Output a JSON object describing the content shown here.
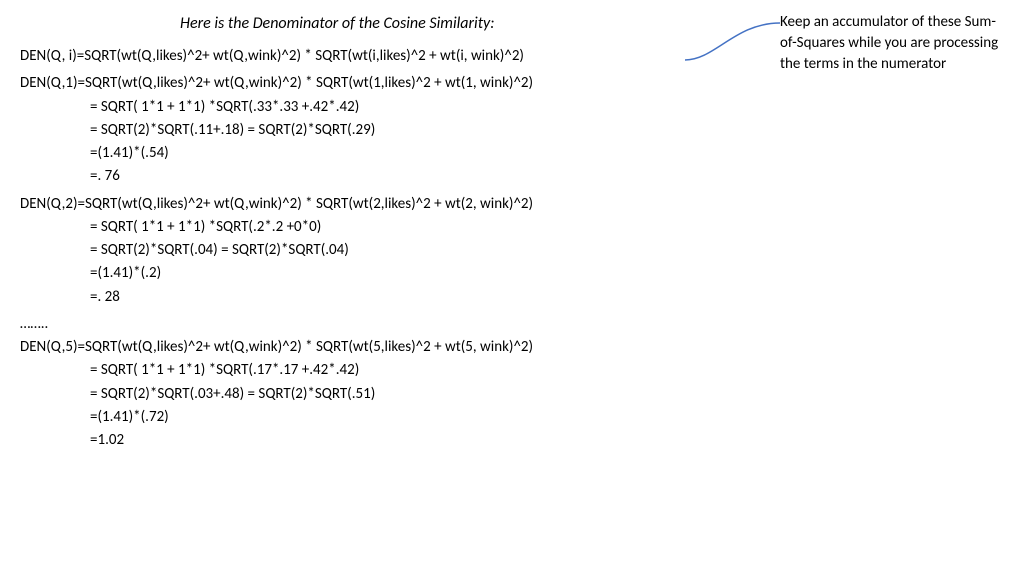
{
  "title": "Here is the Denominator of the Cosine Similarity:",
  "general": "DEN(Q, i)=SQRT(wt(Q,likes)^2+ wt(Q,wink)^2) * SQRT(wt(i,likes)^2 + wt(i, wink)^2)",
  "d1": {
    "l0": "DEN(Q,1)=SQRT(wt(Q,likes)^2+ wt(Q,wink)^2) * SQRT(wt(1,likes)^2 + wt(1, wink)^2)",
    "l1": "= SQRT( 1*1 + 1*1) *SQRT(.33*.33 +.42*.42)",
    "l2": "= SQRT(2)*SQRT(.11+.18) = SQRT(2)*SQRT(.29)",
    "l3": "=(1.41)*(.54)",
    "l4": "=. 76"
  },
  "d2": {
    "l0": "DEN(Q,2)=SQRT(wt(Q,likes)^2+ wt(Q,wink)^2) * SQRT(wt(2,likes)^2 + wt(2, wink)^2)",
    "l1": "= SQRT( 1*1 + 1*1) *SQRT(.2*.2 +0*0)",
    "l2": "= SQRT(2)*SQRT(.04) = SQRT(2)*SQRT(.04)",
    "l3": "=(1.41)*(.2)",
    "l4": "=. 28"
  },
  "ellipsis": "……..",
  "d5": {
    "l0": "DEN(Q,5)=SQRT(wt(Q,likes)^2+ wt(Q,wink)^2) * SQRT(wt(5,likes)^2 + wt(5, wink)^2)",
    "l1": "= SQRT( 1*1 + 1*1) *SQRT(.17*.17 +.42*.42)",
    "l2": "= SQRT(2)*SQRT(.03+.48) = SQRT(2)*SQRT(.51)",
    "l3": "=(1.41)*(.72)",
    "l4": "=1.02"
  },
  "annotation": "Keep an accumulator of these Sum-of-Squares while you are processing the terms in the numerator"
}
